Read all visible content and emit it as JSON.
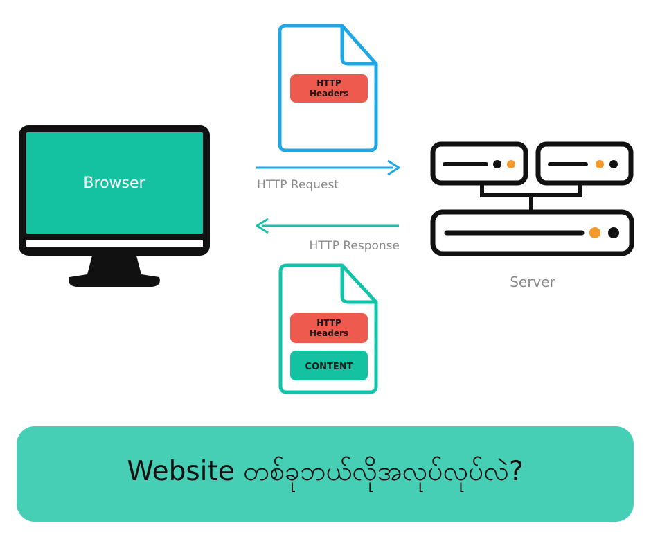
{
  "browser": {
    "label": "Browser"
  },
  "server": {
    "label": "Server"
  },
  "request": {
    "label": "HTTP Request",
    "document": {
      "headers_line1": "HTTP",
      "headers_line2": "Headers"
    }
  },
  "response": {
    "label": "HTTP Response",
    "document": {
      "headers_line1": "HTTP",
      "headers_line2": "Headers",
      "content": "CONTENT"
    }
  },
  "banner": {
    "text": "Website တစ်ခုဘယ်လိုအလုပ်လုပ်လဲ?"
  },
  "colors": {
    "request_blue": "#1ea7e4",
    "response_teal": "#12c3a8",
    "screen_green": "#14c2a2",
    "header_red": "#ef5a4f",
    "indicator_orange": "#f59a2c",
    "banner_teal": "#46cfb5",
    "muted_text": "#8a8a8a"
  }
}
